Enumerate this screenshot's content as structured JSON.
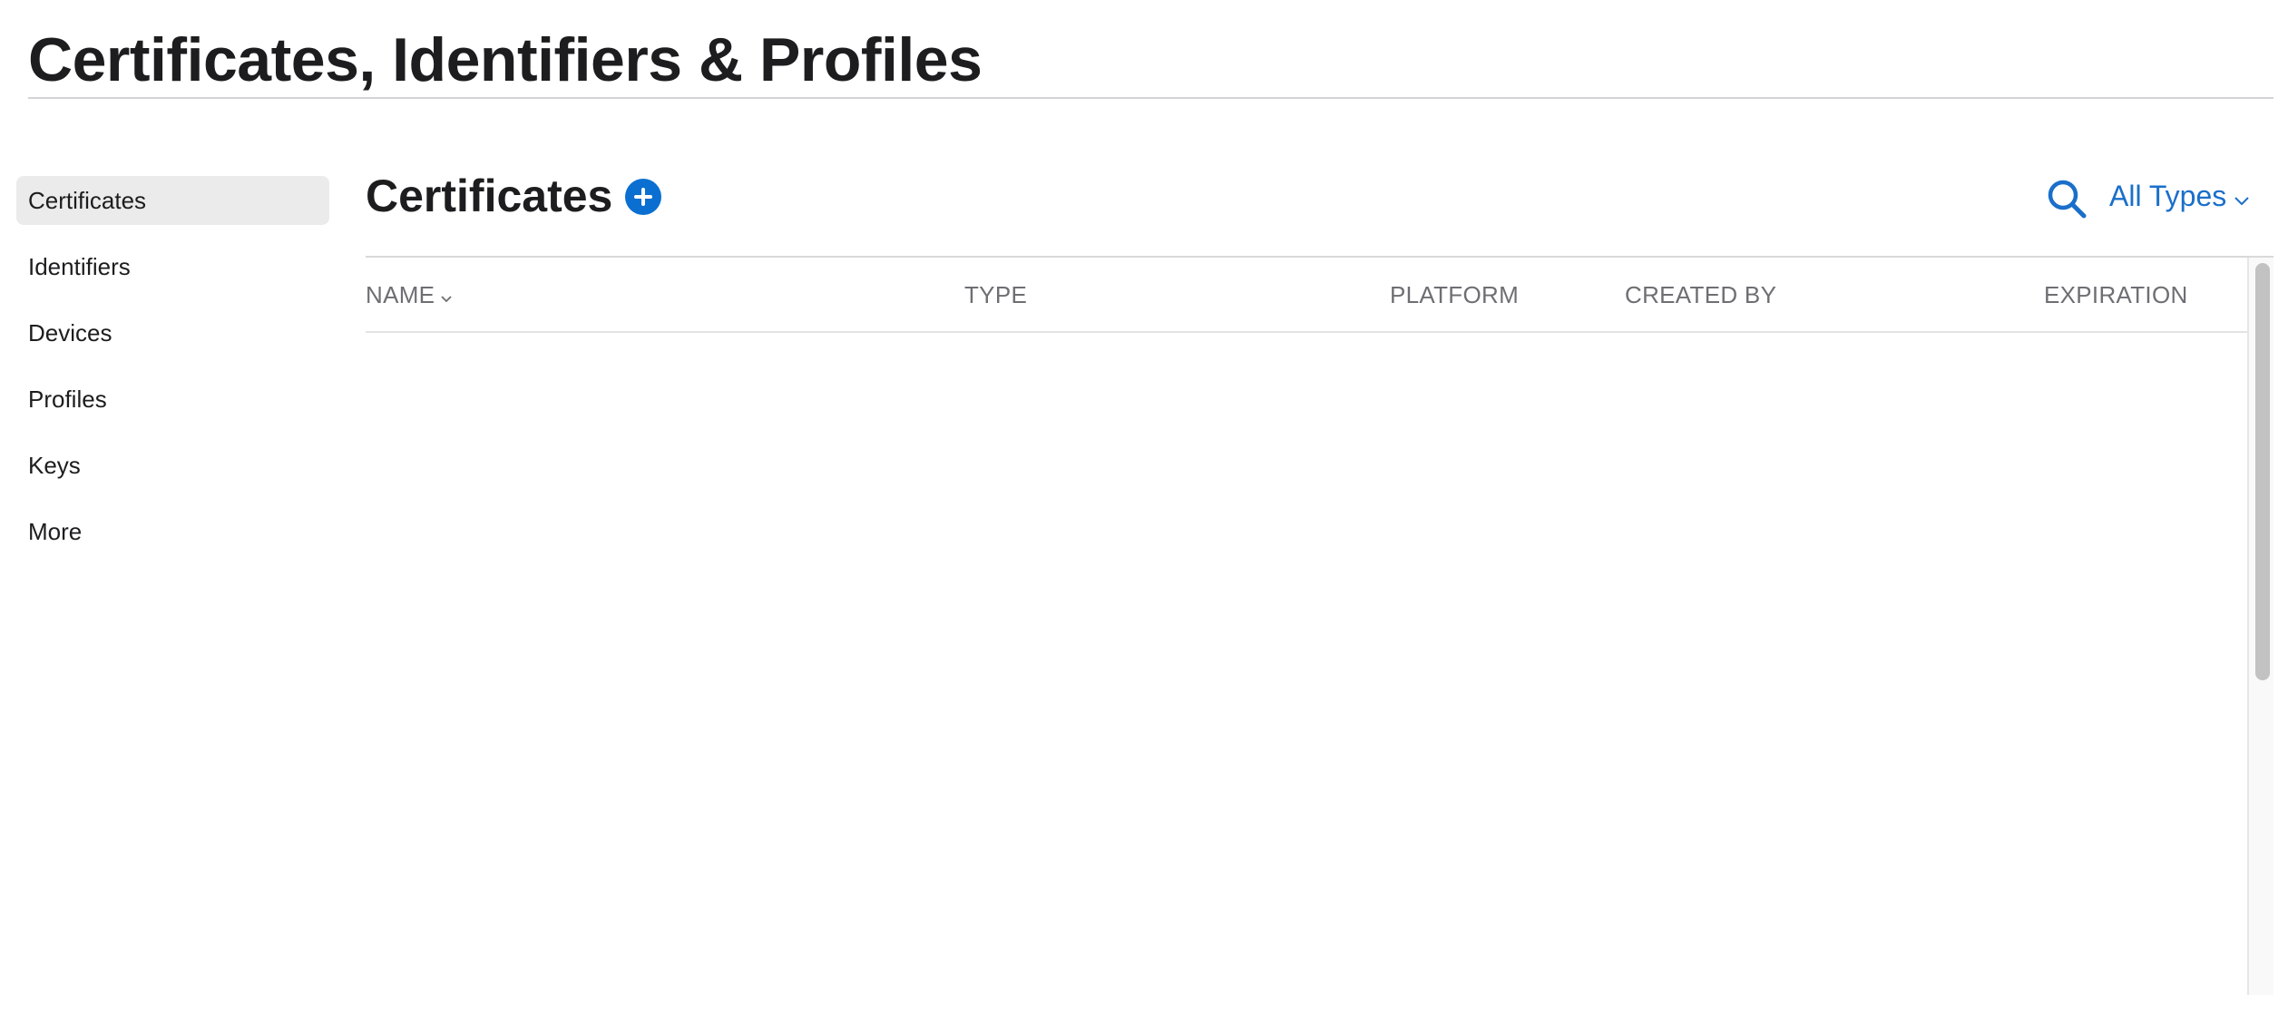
{
  "header": {
    "title": "Certificates, Identifiers & Profiles"
  },
  "sidebar": {
    "selected": "Certificates",
    "items": [
      {
        "label": "Certificates"
      },
      {
        "label": "Identifiers"
      },
      {
        "label": "Devices"
      },
      {
        "label": "Profiles"
      },
      {
        "label": "Keys"
      },
      {
        "label": "More"
      }
    ]
  },
  "main": {
    "section_title": "Certificates",
    "add_icon": "plus-circle-icon",
    "search_icon": "search-icon",
    "filter_label": "All Types",
    "table": {
      "columns": [
        {
          "label": "NAME",
          "sortable": true
        },
        {
          "label": "TYPE"
        },
        {
          "label": "PLATFORM"
        },
        {
          "label": "CREATED BY"
        },
        {
          "label": "EXPIRATION"
        }
      ],
      "rows": []
    }
  },
  "colors": {
    "accent": "#0a6fd0",
    "link": "#1a6fca",
    "selected_bg": "#ebebeb",
    "header_text": "#6e6e73"
  }
}
